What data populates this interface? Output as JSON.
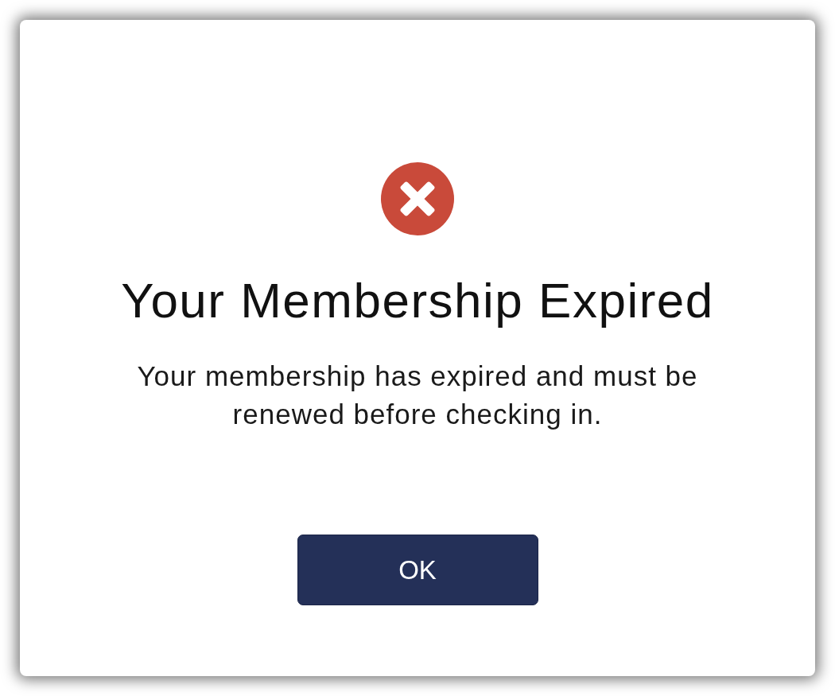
{
  "dialog": {
    "title": "Your Membership Expired",
    "message": "Your membership has expired and must be renewed before checking in.",
    "buttons": [
      {
        "label": "OK",
        "kind": "primary"
      }
    ]
  }
}
